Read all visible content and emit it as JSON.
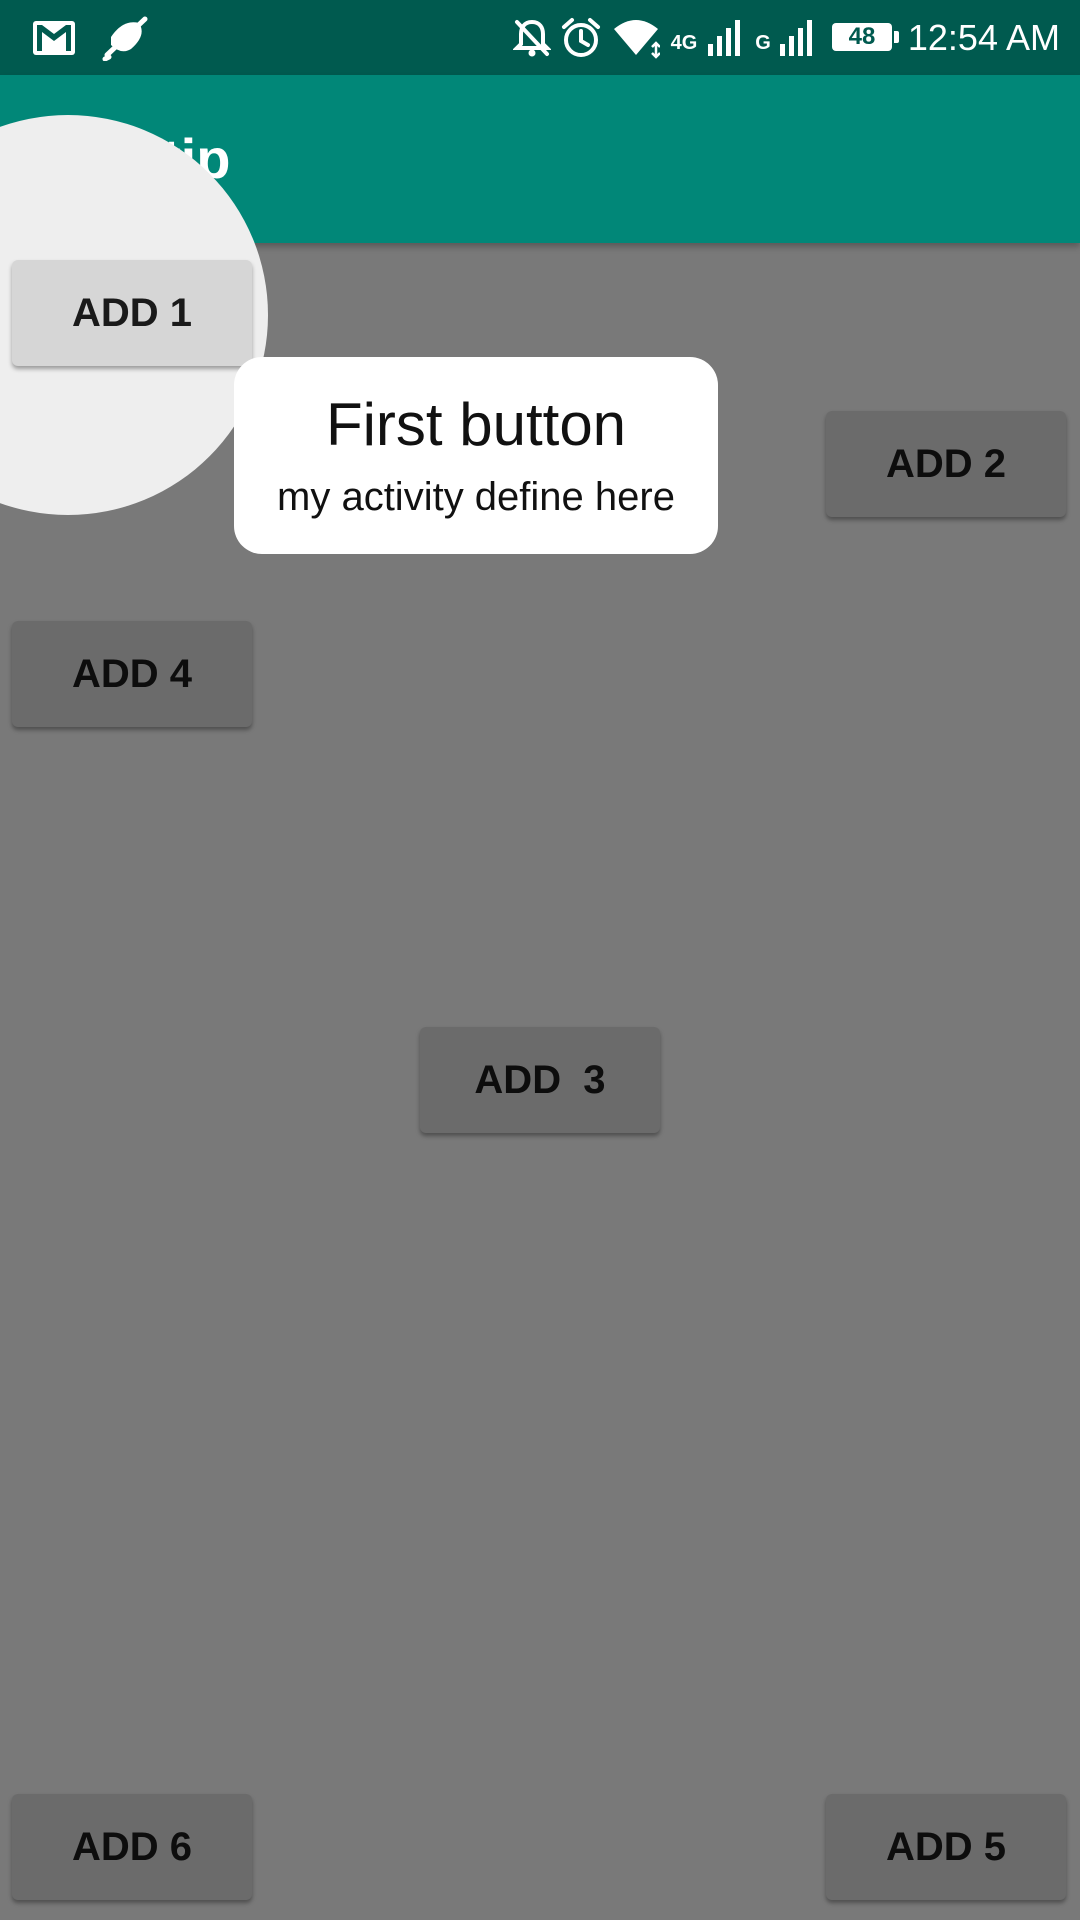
{
  "status_bar": {
    "time": "12:54 AM",
    "battery": "48",
    "network_1": "4G",
    "network_2": "G",
    "icons": [
      "gmail-icon",
      "mute-mic-icon",
      "notifications-off-icon",
      "alarm-icon",
      "wifi-icon",
      "signal-icon",
      "signal-icon",
      "battery-icon"
    ]
  },
  "app_bar": {
    "title": "Tooltip"
  },
  "buttons": {
    "add1": "ADD 1",
    "add2": "ADD 2",
    "add3": "ADD  3",
    "add4": "ADD 4",
    "add5": "ADD 5",
    "add6": "ADD 6"
  },
  "tooltip": {
    "title": "First button",
    "description": "my activity define here"
  },
  "colors": {
    "status_bar": "#005a4f",
    "app_bar": "#018778",
    "button": "#d6d6d6",
    "overlay": "rgba(0,0,0,0.5)",
    "spotlight": "#eeeeee",
    "tooltip": "#ffffff"
  }
}
